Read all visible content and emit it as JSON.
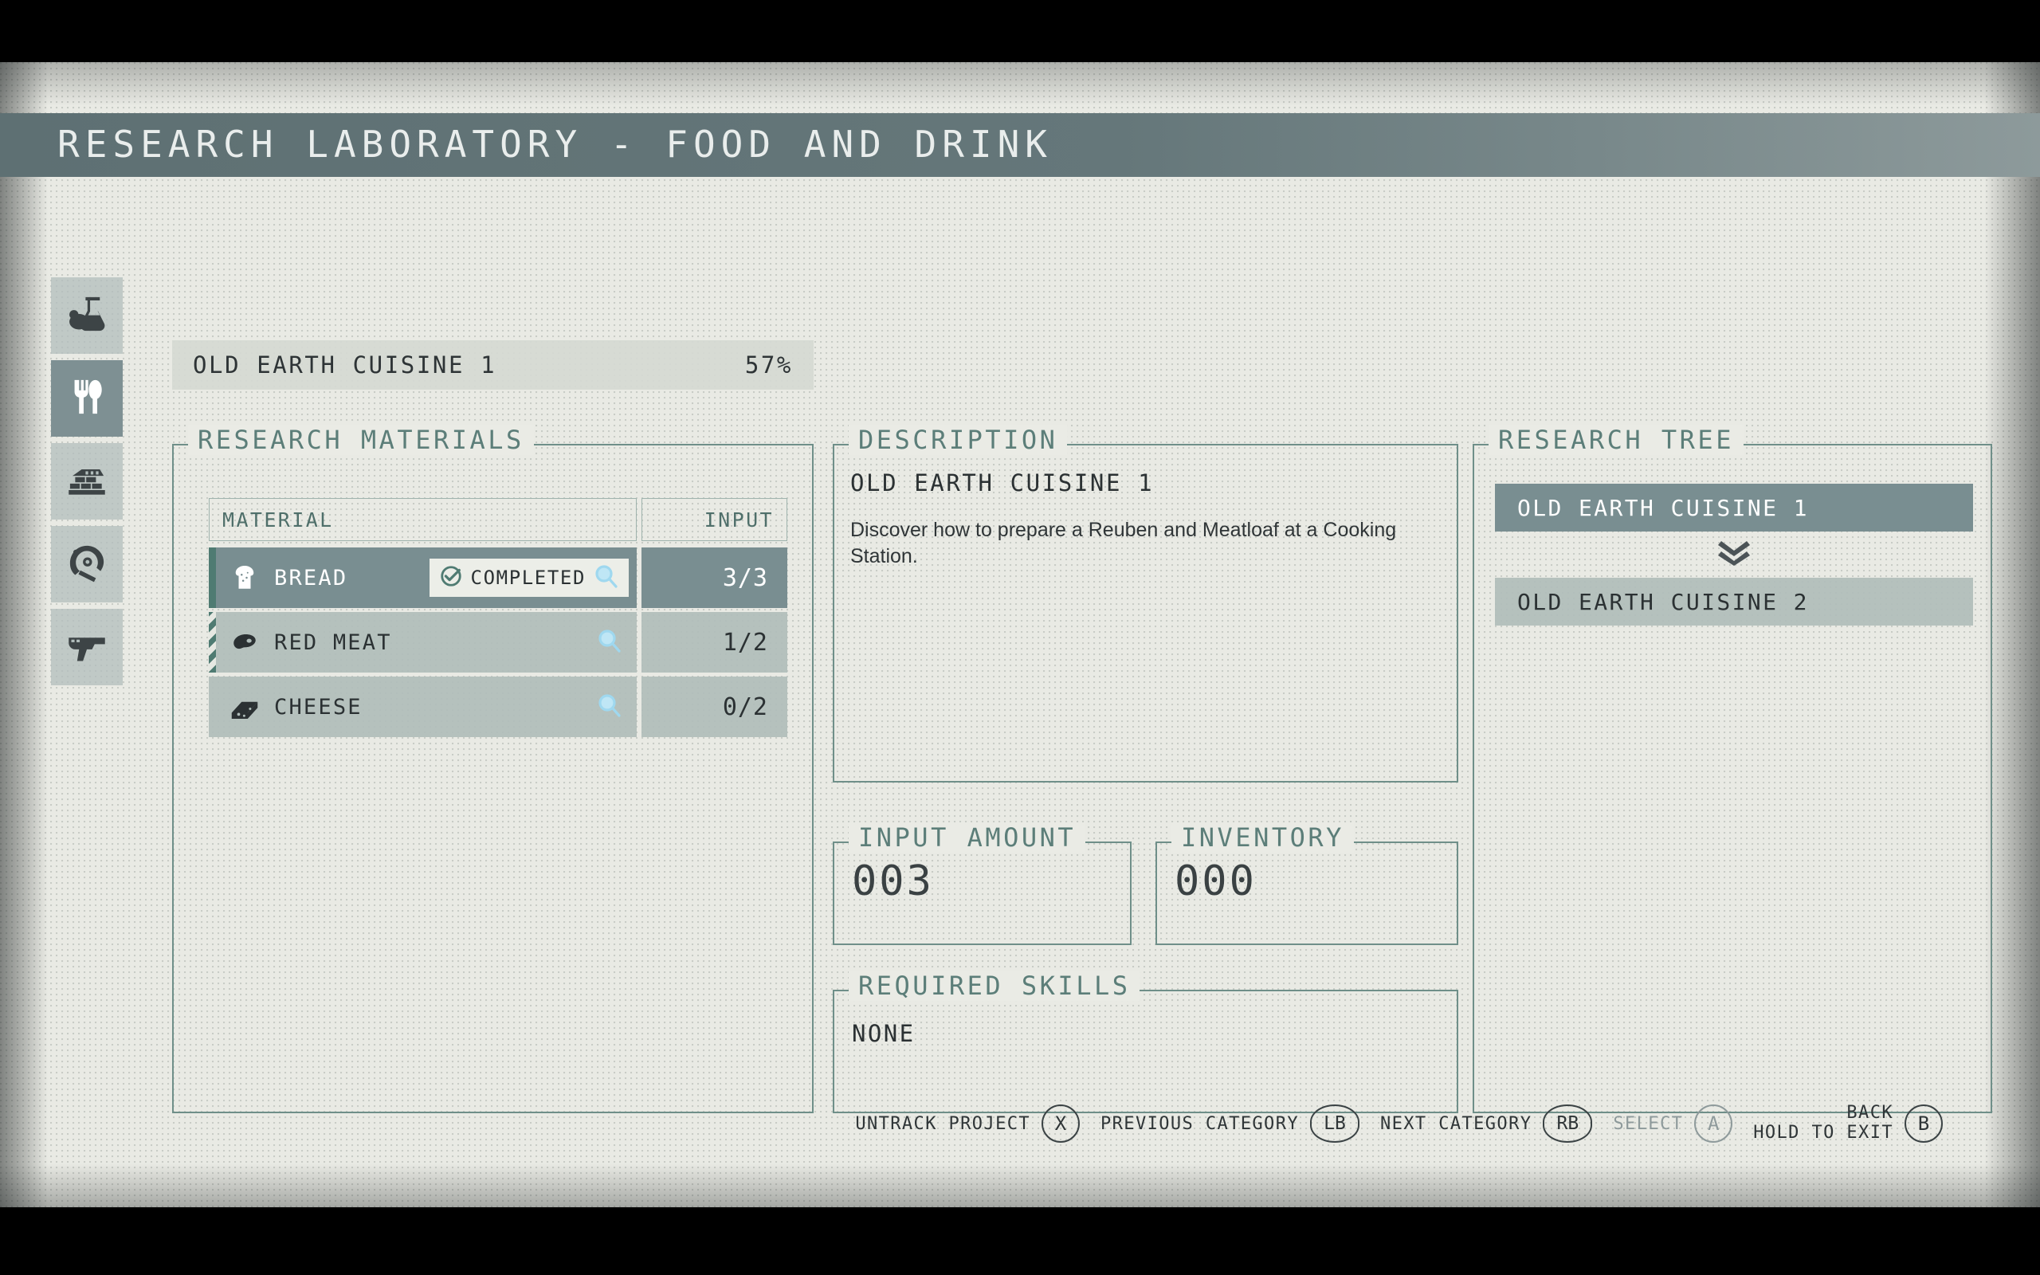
{
  "header": {
    "title": "RESEARCH LABORATORY - FOOD AND DRINK"
  },
  "sidebar": {
    "items": [
      {
        "name": "pharmacology",
        "icon": "flask-icon",
        "active": false
      },
      {
        "name": "food-and-drink",
        "icon": "cutlery-icon",
        "active": true
      },
      {
        "name": "outpost-development",
        "icon": "wall-icon",
        "active": false
      },
      {
        "name": "equipment",
        "icon": "helmet-icon",
        "active": false
      },
      {
        "name": "weaponry",
        "icon": "pistol-icon",
        "active": false
      }
    ]
  },
  "project": {
    "name": "OLD EARTH CUISINE 1",
    "progress": "57%"
  },
  "materials_panel": {
    "legend": "RESEARCH MATERIALS",
    "columns": {
      "material": "MATERIAL",
      "input": "INPUT"
    },
    "rows": [
      {
        "icon": "bread-icon",
        "name": "BREAD",
        "input": "3/3",
        "selected": true,
        "accent": "solid",
        "status": "COMPLETED"
      },
      {
        "icon": "meat-icon",
        "name": "RED MEAT",
        "input": "1/2",
        "selected": false,
        "accent": "striped",
        "status": ""
      },
      {
        "icon": "cheese-icon",
        "name": "CHEESE",
        "input": "0/2",
        "selected": false,
        "accent": "none",
        "status": ""
      }
    ]
  },
  "description_panel": {
    "legend": "DESCRIPTION",
    "title": "OLD EARTH CUISINE 1",
    "body": "Discover how to prepare a Reuben and Meatloaf at a Cooking Station."
  },
  "input_amount_panel": {
    "legend": "INPUT AMOUNT",
    "value": "003"
  },
  "inventory_panel": {
    "legend": "INVENTORY",
    "value": "000"
  },
  "required_skills_panel": {
    "legend": "REQUIRED SKILLS",
    "value": "NONE"
  },
  "research_tree_panel": {
    "legend": "RESEARCH TREE",
    "nodes": [
      {
        "label": "OLD EARTH CUISINE 1",
        "current": true
      },
      {
        "label": "OLD EARTH CUISINE 2",
        "current": false
      }
    ]
  },
  "footer_hints": [
    {
      "label": "UNTRACK PROJECT",
      "button": "X",
      "dim": false,
      "wide": false
    },
    {
      "label": "PREVIOUS CATEGORY",
      "button": "LB",
      "dim": false,
      "wide": true
    },
    {
      "label": "NEXT CATEGORY",
      "button": "RB",
      "dim": false,
      "wide": true
    },
    {
      "label": "SELECT",
      "button": "A",
      "dim": true,
      "wide": false
    },
    {
      "label": "BACK",
      "label2": "HOLD TO EXIT",
      "button": "B",
      "dim": false,
      "wide": false
    }
  ],
  "colors": {
    "accent_teal": "#5c7e79",
    "panel_border": "#6f8f89",
    "row_bg": "#b0bdba",
    "row_selected_bg": "#798e91",
    "titlebar": "#5e7073",
    "background": "#e9eae4",
    "magnifier_blue": "#bfe6f5"
  }
}
